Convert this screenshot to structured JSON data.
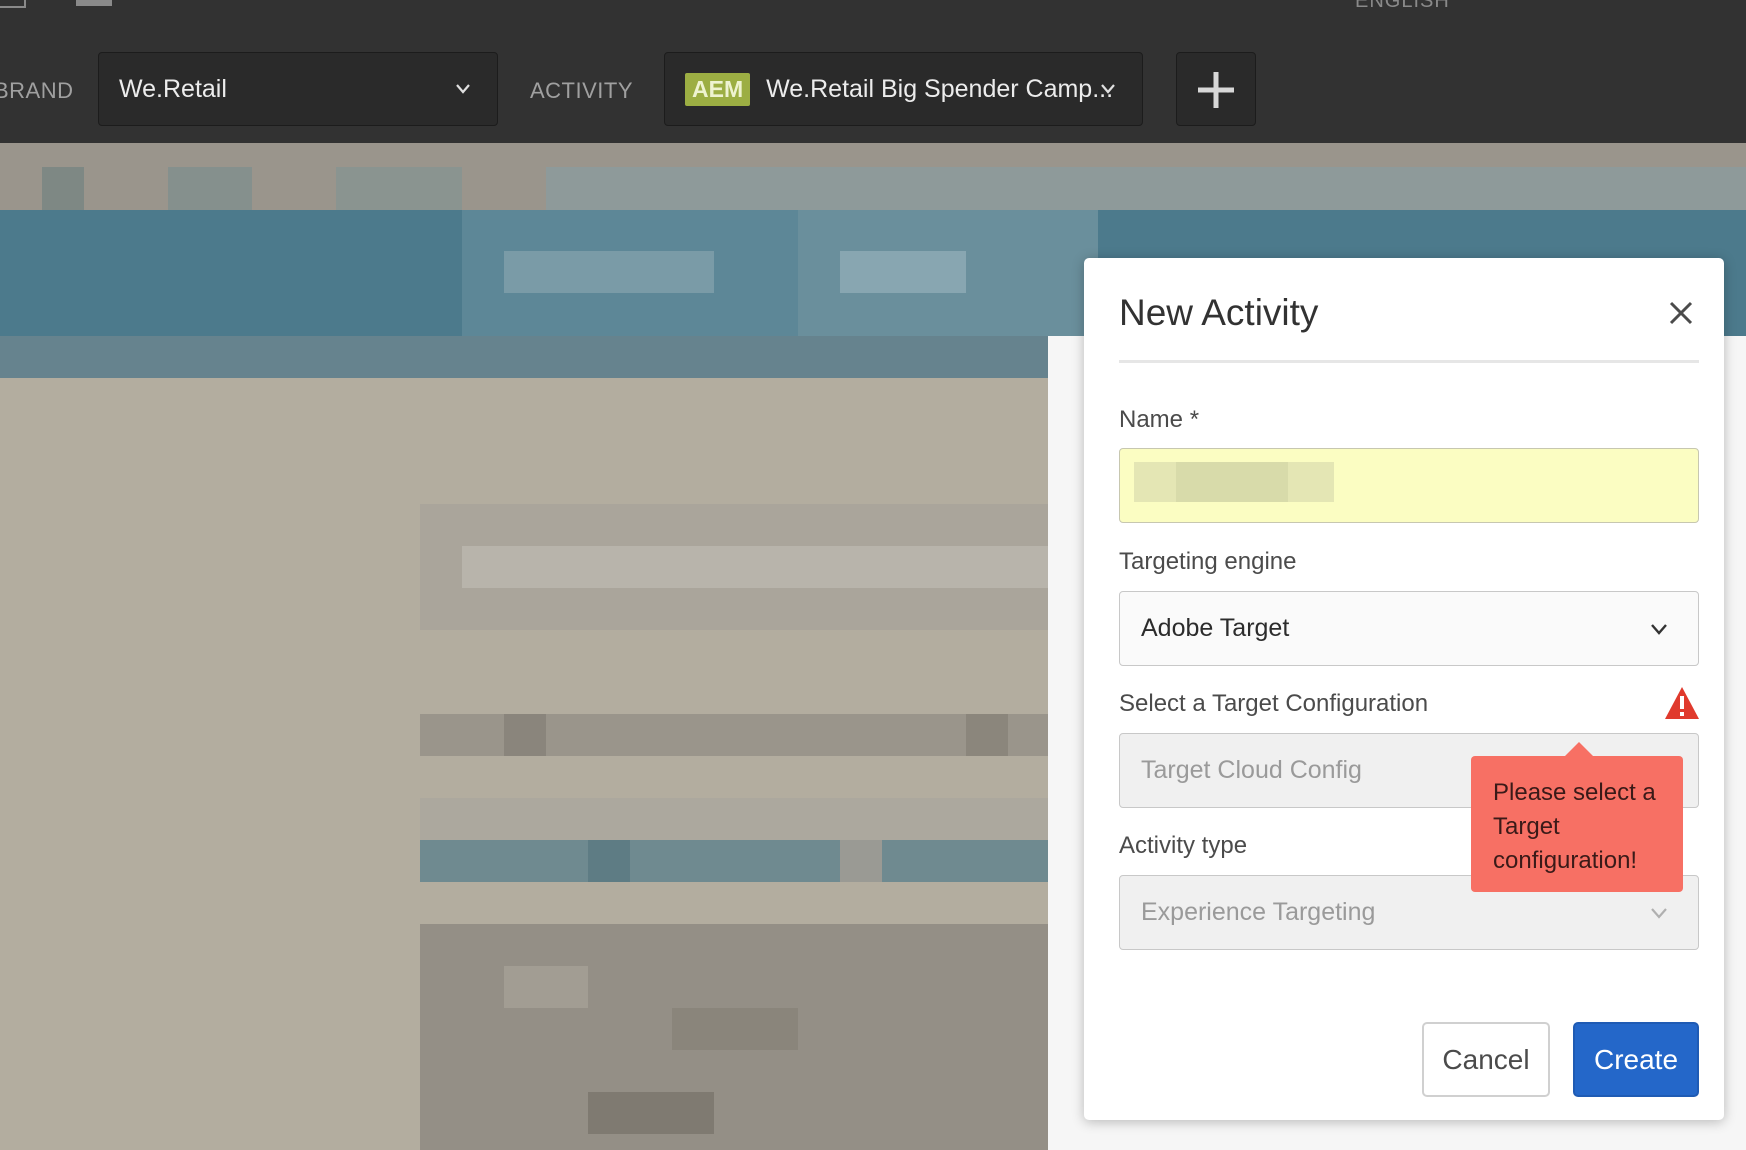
{
  "toolbar": {
    "language": "ENGLISH",
    "brand_label": "BRAND",
    "brand_value": "We.Retail",
    "activity_label": "ACTIVITY",
    "activity_badge": "AEM",
    "activity_value": "We.Retail Big Spender Camp...",
    "add_icon": "plus-icon"
  },
  "dialog": {
    "title": "New Activity",
    "close_icon": "close-icon",
    "name_label": "Name *",
    "name_value": "",
    "engine_label": "Targeting engine",
    "engine_value": "Adobe Target",
    "config_label": "Select a Target Configuration",
    "config_placeholder": "Target Cloud Config",
    "warning_icon": "warning-triangle-icon",
    "tooltip": "Please select a Target configuration!",
    "type_label": "Activity type",
    "type_value": "Experience Targeting",
    "cancel_label": "Cancel",
    "create_label": "Create"
  },
  "colors": {
    "toolbar_bg": "#323232",
    "aem_badge": "#9cae43",
    "name_input_highlight": "#fbfdc2",
    "error_tooltip": "#f77064",
    "warning_red": "#e03a2d",
    "primary_button": "#2467c9"
  }
}
